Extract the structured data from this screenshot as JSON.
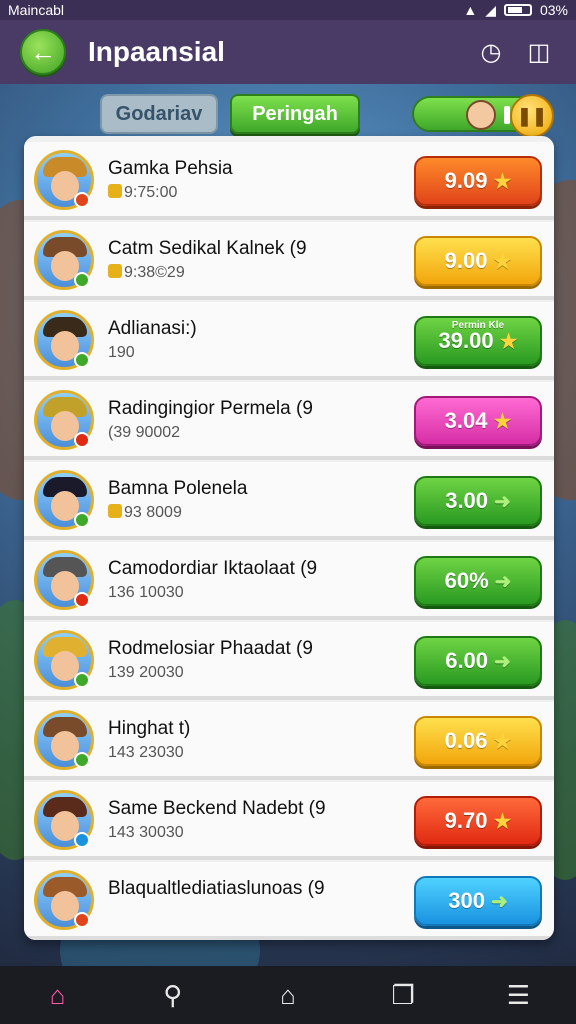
{
  "status_bar": {
    "carrier": "Maincabl",
    "battery": "03%"
  },
  "app_bar": {
    "title": "Inpaansial"
  },
  "tabs": [
    {
      "label": "Godariav"
    },
    {
      "label": "Peringah"
    }
  ],
  "rows": [
    {
      "title": "Gamka Pehsia",
      "sub": "9:75:00",
      "sub_coin": true,
      "price": "9.09",
      "btn_color": "orange",
      "mark": "star"
    },
    {
      "title": "Catm Sedikal Kalnek (9",
      "sub": "9:38©29",
      "sub_coin": true,
      "price": "9.00",
      "btn_color": "yellow",
      "mark": "star"
    },
    {
      "title": "Adlianasi:)",
      "sub": "190",
      "sub_coin": false,
      "price": "39.00",
      "btn_color": "green",
      "mark": "star",
      "tag": "Permin Kle"
    },
    {
      "title": "Radingingior Permela (9",
      "sub": "(39 90002",
      "sub_coin": false,
      "price": "3.04",
      "btn_color": "pink",
      "mark": "star"
    },
    {
      "title": "Bamna Polenela",
      "sub": "93 8009",
      "sub_coin": true,
      "price": "3.00",
      "btn_color": "green",
      "mark": "arrow"
    },
    {
      "title": "Camodordiar Iktaolaat (9",
      "sub": "136 10030",
      "sub_coin": false,
      "price": "60%",
      "btn_color": "green",
      "mark": "arrow"
    },
    {
      "title": "Rodmelosiar Phaadat (9",
      "sub": "139 20030",
      "sub_coin": false,
      "price": "6.00",
      "btn_color": "green",
      "mark": "arrow"
    },
    {
      "title": "Hinghat t)",
      "sub": "143 23030",
      "sub_coin": false,
      "price": "0.06",
      "btn_color": "yellow",
      "mark": "star"
    },
    {
      "title": "Same Beckend Nadebt (9",
      "sub": "143 30030",
      "sub_coin": false,
      "price": "9.70",
      "btn_color": "red",
      "mark": "star"
    },
    {
      "title": "Blaqualtlediatiaslunoas (9",
      "sub": "",
      "sub_coin": false,
      "price": "300",
      "btn_color": "blue",
      "mark": "arrow"
    }
  ],
  "icons": {
    "back": "arrow-left-icon",
    "header_1": "clock-icon",
    "header_2": "inbox-icon",
    "nav": [
      "home-icon",
      "search-icon",
      "house-icon",
      "copy-icon",
      "menu-icon"
    ]
  },
  "colors": {
    "app_bar": "#4a3a66",
    "accent_green": "#3fa82a",
    "nav_active": "#ff5aa8"
  }
}
